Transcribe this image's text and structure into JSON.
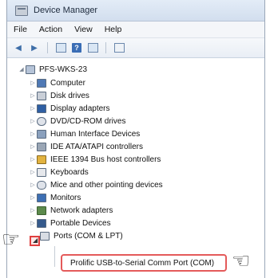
{
  "window": {
    "title": "Device Manager"
  },
  "menu": [
    "File",
    "Action",
    "View",
    "Help"
  ],
  "toolbar": [
    {
      "icon": "back-arrow-icon",
      "glyph": "◀"
    },
    {
      "icon": "forward-arrow-icon",
      "glyph": "▶"
    },
    {
      "icon": "properties-icon"
    },
    {
      "icon": "help-icon",
      "glyph": "?"
    },
    {
      "icon": "details-icon"
    },
    {
      "icon": "scan-hardware-icon"
    }
  ],
  "tree": {
    "root": "PFS-WKS-23",
    "items": [
      {
        "label": "Computer",
        "icon": "computer-icon"
      },
      {
        "label": "Disk drives",
        "icon": "disk-drive-icon"
      },
      {
        "label": "Display adapters",
        "icon": "display-adapter-icon"
      },
      {
        "label": "DVD/CD-ROM drives",
        "icon": "dvd-drive-icon"
      },
      {
        "label": "Human Interface Devices",
        "icon": "hid-icon"
      },
      {
        "label": "IDE ATA/ATAPI controllers",
        "icon": "ide-controller-icon"
      },
      {
        "label": "IEEE 1394 Bus host controllers",
        "icon": "ieee1394-icon"
      },
      {
        "label": "Keyboards",
        "icon": "keyboard-icon"
      },
      {
        "label": "Mice and other pointing devices",
        "icon": "mouse-icon"
      },
      {
        "label": "Monitors",
        "icon": "monitor-icon"
      },
      {
        "label": "Network adapters",
        "icon": "network-adapter-icon"
      },
      {
        "label": "Portable Devices",
        "icon": "portable-device-icon"
      },
      {
        "label": "Ports (COM & LPT)",
        "icon": "port-icon"
      }
    ],
    "highlighted_child": "Prolific USB-to-Serial Comm Port (COM)"
  },
  "colors": {
    "highlight_border": "#e45a5a",
    "accent": "#3e6ea8"
  }
}
